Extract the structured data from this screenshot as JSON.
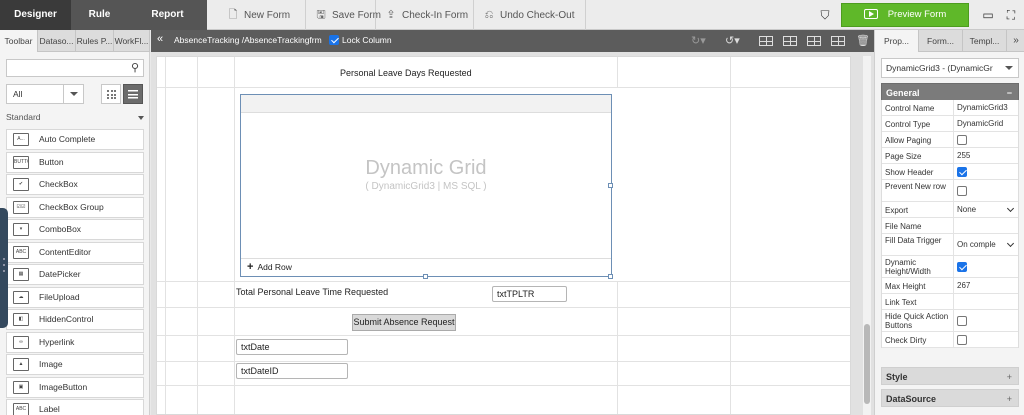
{
  "topbar": {
    "modes": [
      "Designer",
      "Rule",
      "Report"
    ],
    "actions": {
      "new_form": "New Form",
      "save_form": "Save Form",
      "check_in": "Check-In Form",
      "undo_checkout": "Undo Check-Out"
    },
    "preview": "Preview Form"
  },
  "toolbox": {
    "tabs": [
      "Toolbar",
      "Dataso...",
      "Rules P...",
      "WorkFl..."
    ],
    "filter": "All",
    "section": "Standard",
    "items": [
      {
        "label": "Auto Complete",
        "icon": "auto-complete-icon",
        "glyph": "A..."
      },
      {
        "label": "Button",
        "icon": "button-icon",
        "glyph": "BUTTON"
      },
      {
        "label": "CheckBox",
        "icon": "checkbox-icon",
        "glyph": "✔"
      },
      {
        "label": "CheckBox Group",
        "icon": "checkbox-group-icon",
        "glyph": "☑☑"
      },
      {
        "label": "ComboBox",
        "icon": "combobox-icon",
        "glyph": "▾"
      },
      {
        "label": "ContentEditor",
        "icon": "content-editor-icon",
        "glyph": "ABC"
      },
      {
        "label": "DatePicker",
        "icon": "datepicker-icon",
        "glyph": "▦"
      },
      {
        "label": "FileUpload",
        "icon": "file-upload-icon",
        "glyph": "☁"
      },
      {
        "label": "HiddenControl",
        "icon": "hidden-control-icon",
        "glyph": "◧"
      },
      {
        "label": "Hyperlink",
        "icon": "hyperlink-icon",
        "glyph": "∞"
      },
      {
        "label": "Image",
        "icon": "image-icon",
        "glyph": "▲"
      },
      {
        "label": "ImageButton",
        "icon": "image-button-icon",
        "glyph": "▣"
      },
      {
        "label": "Label",
        "icon": "label-icon",
        "glyph": "ABC"
      }
    ]
  },
  "designer": {
    "path": "AbsenceTracking /AbsenceTrackingfrm",
    "lock_column": "Lock Column",
    "form": {
      "personal_leave_label": "Personal Leave Days Requested",
      "grid_title": "Dynamic Grid",
      "grid_subtitle": "( DynamicGrid3 | MS SQL )",
      "add_row": "Add Row",
      "total_label": "Total Personal Leave Time Requested",
      "txt_tpltr": "txtTPLTR",
      "submit": "Submit Absence Request",
      "txt_date": "txtDate",
      "txt_date_id": "txtDateID"
    }
  },
  "properties": {
    "tabs": [
      "Prop...",
      "Form...",
      "Templ..."
    ],
    "selected_control": "DynamicGrid3 - (DynamicGr",
    "groups": {
      "general": "General",
      "style": "Style",
      "datasource": "DataSource"
    },
    "rows": [
      {
        "name": "Control Name",
        "value": "DynamicGrid3",
        "kind": "text"
      },
      {
        "name": "Control Type",
        "value": "DynamicGrid",
        "kind": "text"
      },
      {
        "name": "Allow Paging",
        "checked": false,
        "kind": "check"
      },
      {
        "name": "Page Size",
        "value": "255",
        "kind": "text"
      },
      {
        "name": "Show Header",
        "checked": true,
        "kind": "check"
      },
      {
        "name": "Prevent New row",
        "checked": false,
        "kind": "check"
      },
      {
        "name": "Export",
        "value": "None",
        "kind": "select"
      },
      {
        "name": "File Name",
        "value": "",
        "kind": "text"
      },
      {
        "name": "Fill Data Trigger",
        "value": "On comple",
        "kind": "select"
      },
      {
        "name": "Dynamic Height/Width",
        "checked": true,
        "kind": "check"
      },
      {
        "name": "Max Height",
        "value": "267",
        "kind": "text"
      },
      {
        "name": "Link Text",
        "value": "",
        "kind": "text"
      },
      {
        "name": "Hide Quick Action Buttons",
        "checked": false,
        "kind": "check"
      },
      {
        "name": "Check Dirty",
        "checked": false,
        "kind": "check"
      }
    ]
  },
  "colors": {
    "preview_green": "#5fb829",
    "accent_blue": "#1a73e8",
    "dark_bar": "#5c5c5c"
  }
}
